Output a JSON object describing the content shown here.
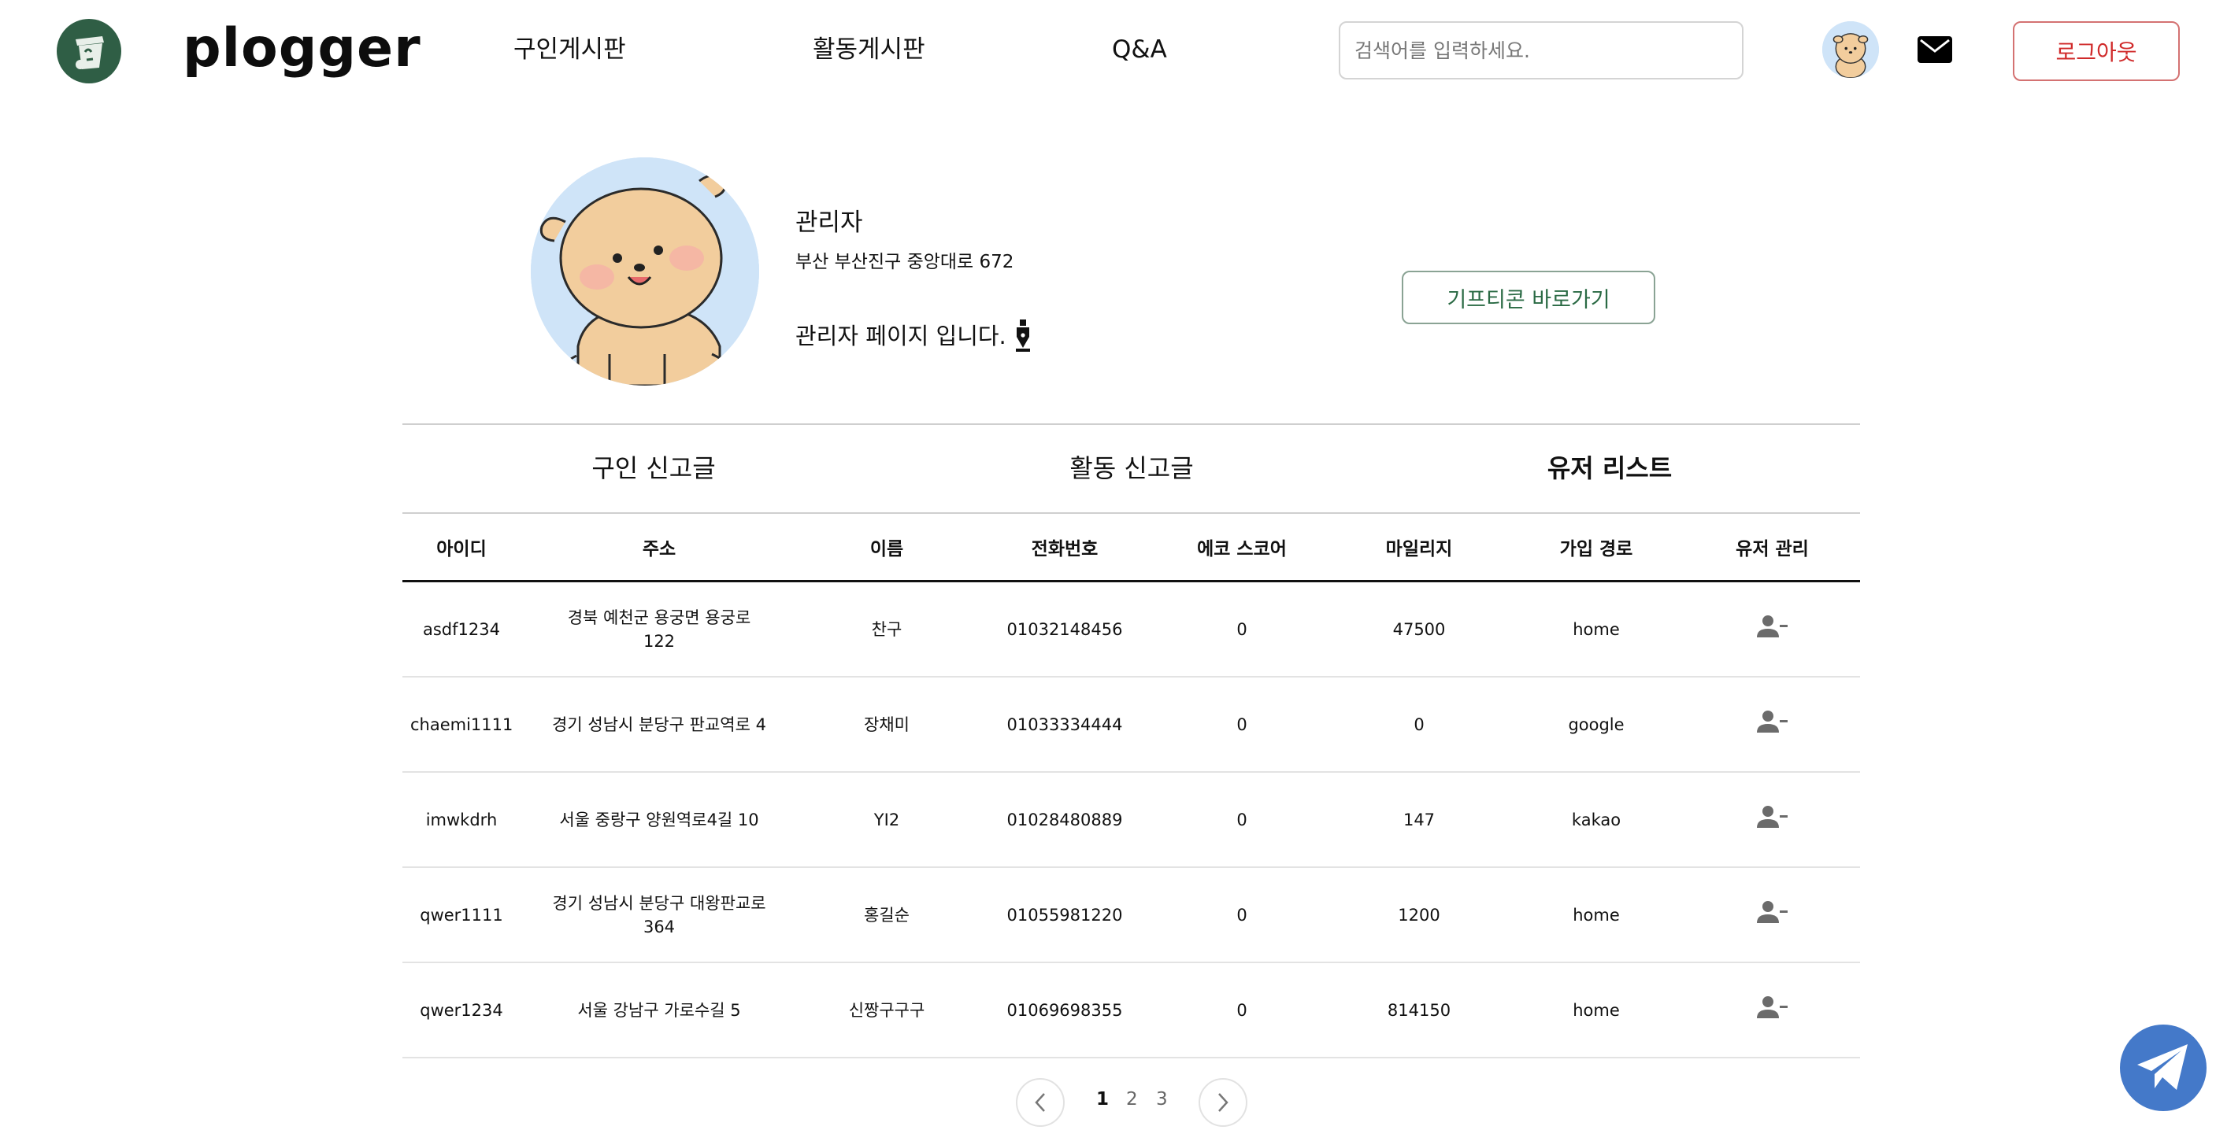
{
  "header": {
    "brand": "plogger",
    "nav": [
      "구인게시판",
      "활동게시판",
      "Q&A"
    ],
    "search_placeholder": "검색어를 입력하세요.",
    "logout_label": "로그아웃"
  },
  "profile": {
    "name": "관리자",
    "address": "부산 부산진구 중앙대로 672",
    "bio": "관리자 페이지 입니다.",
    "gift_button": "기프티콘 바로가기"
  },
  "tabs": [
    "구인 신고글",
    "활동 신고글",
    "유저 리스트"
  ],
  "active_tab": "유저 리스트",
  "table": {
    "headers": [
      "아이디",
      "주소",
      "이름",
      "전화번호",
      "에코 스코어",
      "마일리지",
      "가입 경로",
      "유저 관리"
    ],
    "rows": [
      {
        "id": "asdf1234",
        "address": "경북 예천군 용궁면 용궁로 122",
        "name": "찬구",
        "phone": "01032148456",
        "eco": "0",
        "mileage": "47500",
        "route": "home"
      },
      {
        "id": "chaemi1111",
        "address": "경기 성남시 분당구 판교역로 4",
        "name": "장채미",
        "phone": "01033334444",
        "eco": "0",
        "mileage": "0",
        "route": "google"
      },
      {
        "id": "imwkdrh",
        "address": "서울 중랑구 양원역로4길 10",
        "name": "YI2",
        "phone": "01028480889",
        "eco": "0",
        "mileage": "147",
        "route": "kakao"
      },
      {
        "id": "qwer1111",
        "address": "경기 성남시 분당구 대왕판교로 364",
        "name": "홍길순",
        "phone": "01055981220",
        "eco": "0",
        "mileage": "1200",
        "route": "home"
      },
      {
        "id": "qwer1234",
        "address": "서울 강남구 가로수길 5",
        "name": "신짱구구구",
        "phone": "01069698355",
        "eco": "0",
        "mileage": "814150",
        "route": "home"
      }
    ]
  },
  "pagination": {
    "pages": [
      "1",
      "2",
      "3"
    ],
    "current": "1"
  },
  "icons": {
    "logo": "trash-bin-logo-icon",
    "mail": "mail-icon",
    "pen": "pen-nib-icon",
    "remove_user": "person-remove-icon",
    "send": "paper-plane-icon",
    "prev": "chevron-left-icon",
    "next": "chevron-right-icon"
  },
  "colors": {
    "brand_green": "#2f5e45",
    "logout_red": "#d02a2a",
    "gift_green": "#2a6a44",
    "avatar_bg": "#cfe4f8",
    "telegram_blue": "#4479c9"
  }
}
